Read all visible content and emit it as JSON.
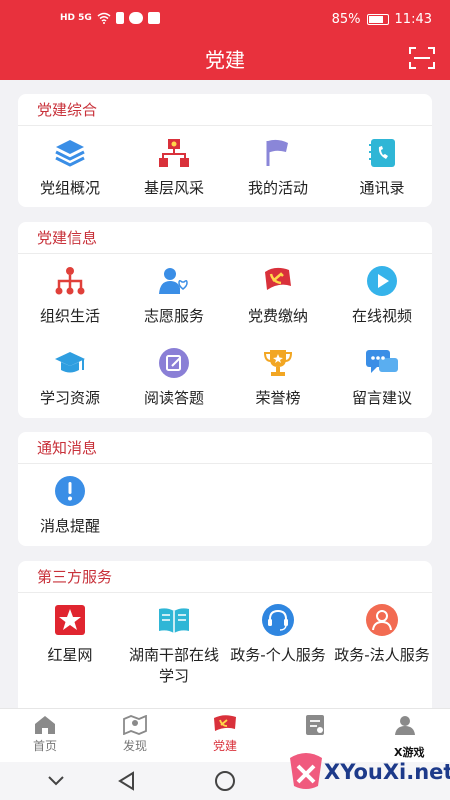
{
  "status_bar": {
    "battery": "85%",
    "time": "11:43",
    "battery_level": 0.85,
    "signal_label": "HD 5G"
  },
  "header": {
    "title": "党建",
    "scan_icon": "scan-frame-icon"
  },
  "sections": [
    {
      "title": "党建综合",
      "items": [
        {
          "label": "党组概况",
          "icon": "layers-icon"
        },
        {
          "label": "基层风采",
          "icon": "org-party-icon"
        },
        {
          "label": "我的活动",
          "icon": "flag-icon"
        },
        {
          "label": "通讯录",
          "icon": "contacts-phone-icon"
        }
      ]
    },
    {
      "title": "党建信息",
      "items": [
        {
          "label": "组织生活",
          "icon": "org-tree-icon"
        },
        {
          "label": "志愿服务",
          "icon": "volunteer-icon"
        },
        {
          "label": "党费缴纳",
          "icon": "party-emblem-icon"
        },
        {
          "label": "在线视频",
          "icon": "play-icon"
        },
        {
          "label": "学习资源",
          "icon": "graduation-cap-icon"
        },
        {
          "label": "阅读答题",
          "icon": "edit-note-icon"
        },
        {
          "label": "荣誉榜",
          "icon": "trophy-icon"
        },
        {
          "label": "留言建议",
          "icon": "chat-bubbles-icon"
        }
      ]
    },
    {
      "title": "通知消息",
      "items": [
        {
          "label": "消息提醒",
          "icon": "alert-icon"
        }
      ]
    },
    {
      "title": "第三方服务",
      "items": [
        {
          "label": "红星网",
          "icon": "red-star-icon"
        },
        {
          "label": "湖南干部在线学习",
          "icon": "book-icon"
        },
        {
          "label": "政务-个人服务",
          "icon": "headset-icon"
        },
        {
          "label": "政务-法人服务",
          "icon": "person-icon"
        }
      ]
    }
  ],
  "tabs": [
    {
      "label": "首页",
      "icon": "home-icon"
    },
    {
      "label": "发现",
      "icon": "map-pin-icon"
    },
    {
      "label": "党建",
      "icon": "party-flag-icon"
    },
    {
      "label": "",
      "icon": "task-list-icon"
    },
    {
      "label": "",
      "icon": "user-icon"
    }
  ],
  "watermark": {
    "text": "XYouXi.net",
    "small": "X游戏"
  },
  "colors": {
    "primary": "#e8313d",
    "section_title": "#c8313a"
  }
}
